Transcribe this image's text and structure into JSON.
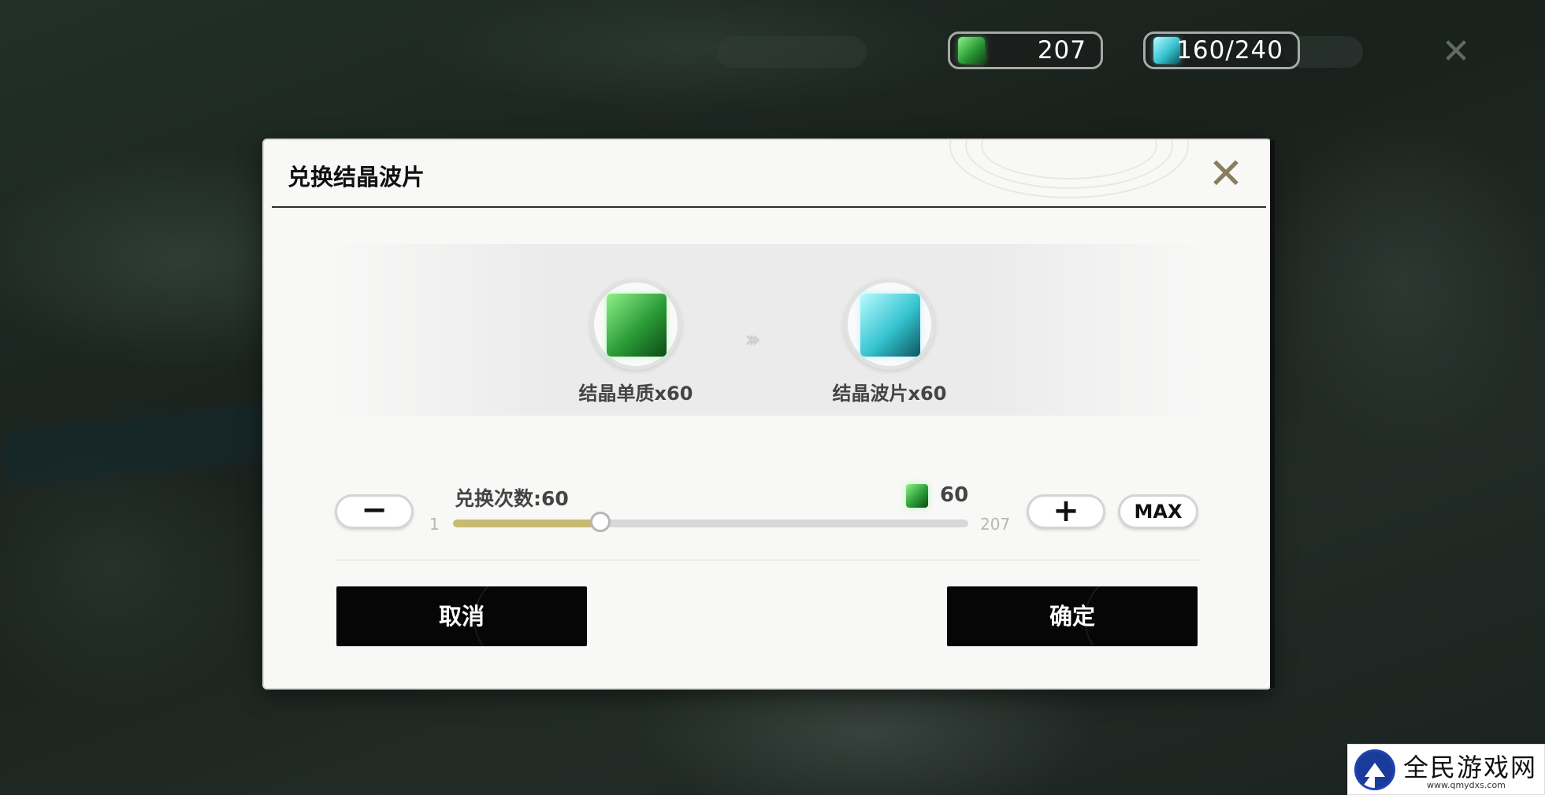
{
  "resources": {
    "monomer": {
      "icon": "green-crystal-icon",
      "count": "207"
    },
    "wave": {
      "icon": "cyan-crystal-icon",
      "count": "160/240"
    }
  },
  "dialog": {
    "title": "兑换结晶波片",
    "source": {
      "icon": "green-crystal-cube-icon",
      "label": "结晶单质x60"
    },
    "target": {
      "icon": "cyan-crystal-cube-icon",
      "label": "结晶波片x60"
    },
    "exchange_count_label": "兑换次数:60",
    "cost_value": "60",
    "slider": {
      "min_label": "1",
      "max_label": "207",
      "min": 1,
      "max": 207,
      "value": 60
    },
    "minus_label": "−",
    "plus_label": "+",
    "max_label": "MAX",
    "cancel_label": "取消",
    "confirm_label": "确定"
  },
  "watermark": {
    "title": "全民游戏网",
    "url": "www.qmydxs.com"
  },
  "colors": {
    "slider_fill": "#c7bb72",
    "button_dark": "#060606",
    "dialog_bg": "#f8f8f7"
  }
}
